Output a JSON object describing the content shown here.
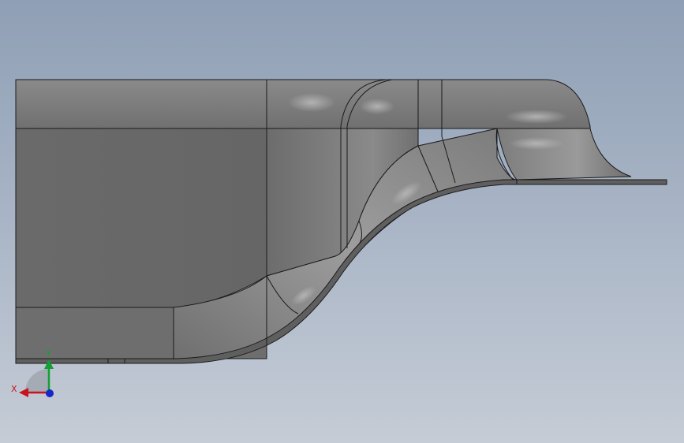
{
  "viewport": {
    "background_top": "#8f9fb5",
    "background_bottom": "#c5ccd6"
  },
  "model": {
    "face_dark": "#6b6b6b",
    "face_mid": "#7a7a7a",
    "face_light": "#9a9a9a",
    "edge_color": "#1a1a1a"
  },
  "triad": {
    "x_label": "X",
    "y_label": "Y",
    "x_color": "#c8141e",
    "y_color": "#14a032",
    "z_color": "#1428c8"
  }
}
